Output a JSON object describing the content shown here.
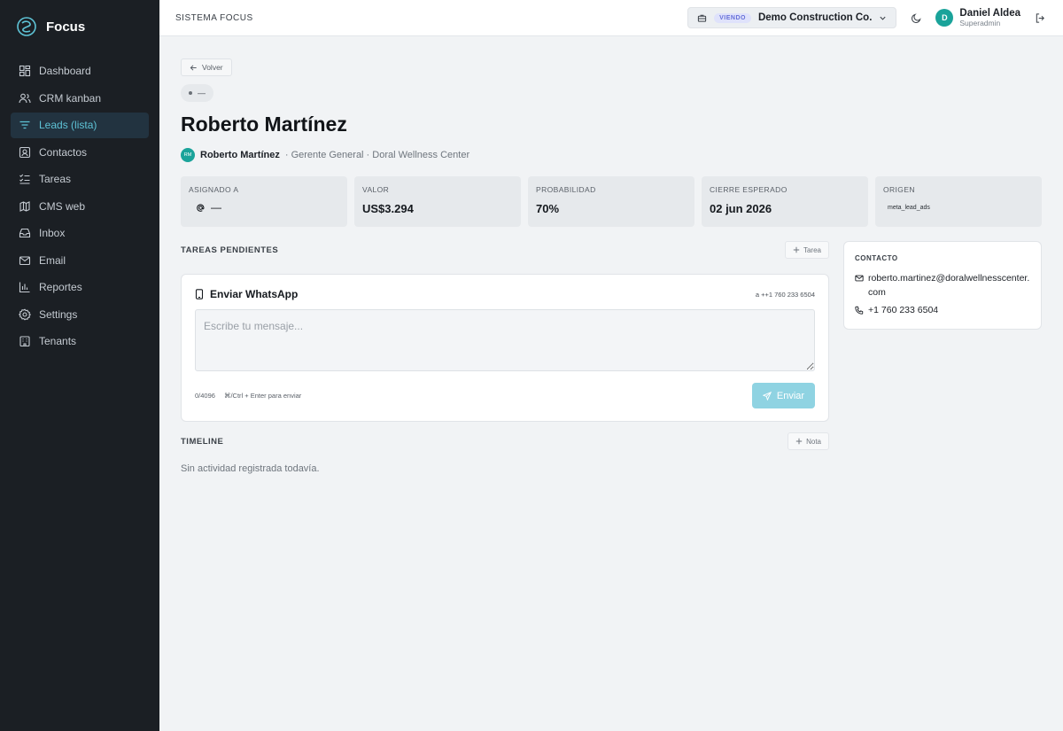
{
  "brand": {
    "name": "Focus"
  },
  "sidebar": {
    "items": [
      {
        "label": "Dashboard",
        "icon": "grid-icon"
      },
      {
        "label": "CRM kanban",
        "icon": "users-icon"
      },
      {
        "label": "Leads (lista)",
        "icon": "filter-icon",
        "active": true
      },
      {
        "label": "Contactos",
        "icon": "contact-icon"
      },
      {
        "label": "Tareas",
        "icon": "checklist-icon"
      },
      {
        "label": "CMS web",
        "icon": "globe-icon"
      },
      {
        "label": "Inbox",
        "icon": "inbox-icon"
      },
      {
        "label": "Email",
        "icon": "mail-icon"
      },
      {
        "label": "Reportes",
        "icon": "bar-chart-icon"
      },
      {
        "label": "Settings",
        "icon": "gear-icon"
      },
      {
        "label": "Tenants",
        "icon": "building-icon"
      }
    ]
  },
  "topbar": {
    "title": "SISTEMA FOCUS",
    "viewing_badge": "VIENDO",
    "tenant": "Demo Construction Co.",
    "user": {
      "initial": "D",
      "name": "Daniel Aldea",
      "role": "Superadmin"
    }
  },
  "lead": {
    "back_label": "Volver",
    "stage": "—",
    "title": "Roberto Martínez",
    "contact_initials": "RM",
    "contact_name": "Roberto Martínez",
    "contact_role": "· Gerente General · Doral Wellness Center"
  },
  "stats": {
    "assigned": {
      "label": "ASIGNADO A",
      "value": "—"
    },
    "value": {
      "label": "VALOR",
      "value": "US$3.294"
    },
    "probability": {
      "label": "PROBABILIDAD",
      "value": "70%"
    },
    "close": {
      "label": "CIERRE ESPERADO",
      "value": "02 jun 2026"
    },
    "origin": {
      "label": "ORIGEN",
      "value": "meta_lead_ads"
    }
  },
  "tasks": {
    "title": "TAREAS PENDIENTES",
    "add_label": "Tarea"
  },
  "whatsapp": {
    "title": "Enviar WhatsApp",
    "to": "a ++1 760 233 6504",
    "placeholder": "Escribe tu mensaje...",
    "counter": "0/4096",
    "hint": "⌘/Ctrl + Enter para enviar",
    "send_label": "Enviar"
  },
  "timeline": {
    "title": "TIMELINE",
    "add_label": "Nota",
    "empty": "Sin actividad registrada todavía."
  },
  "contact": {
    "label": "CONTACTO",
    "email": "roberto.martinez@doralwellnesscenter.com",
    "phone": "+1 760 233 6504"
  }
}
